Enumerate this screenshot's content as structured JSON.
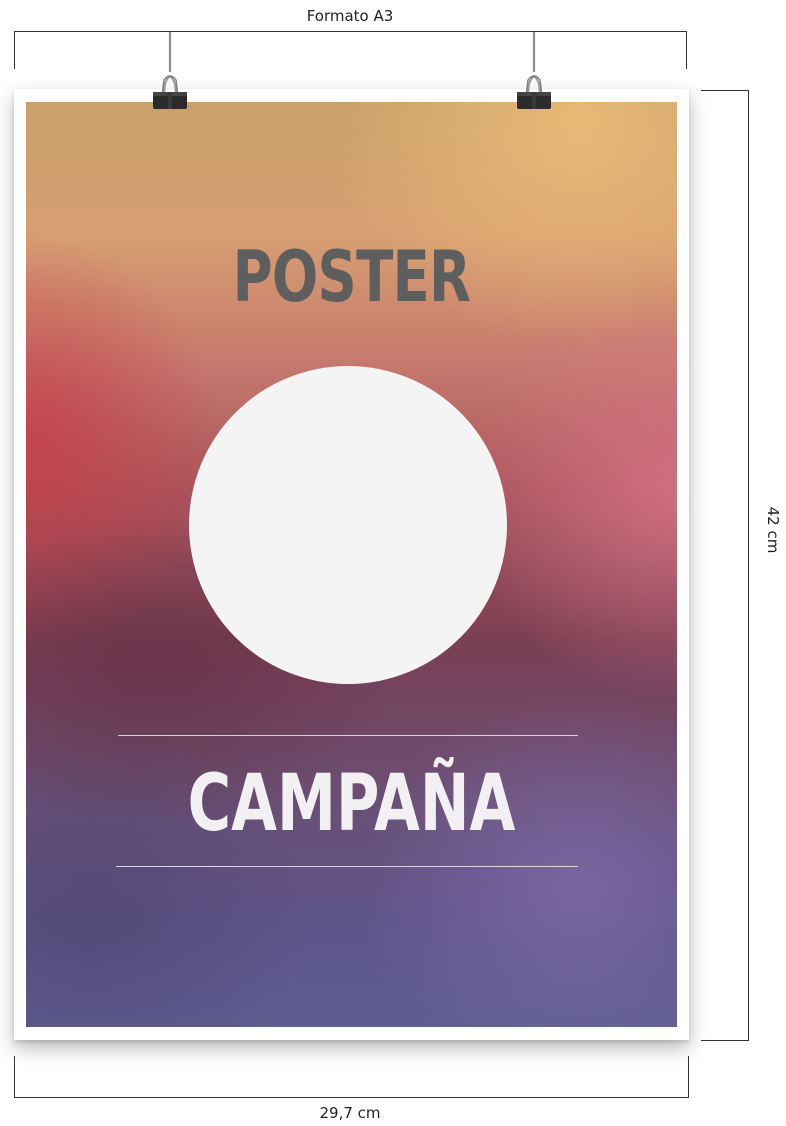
{
  "dimensions": {
    "top_label": "Formato A3",
    "right_label": "42 cm",
    "bottom_label": "29,7 cm"
  },
  "poster": {
    "title": "POSTER",
    "subtitle": "CAMPAÑA"
  },
  "colors": {
    "title_text": "#5e5e5e",
    "subtitle_text": "#f2f0f2",
    "circle": "#f4f4f4",
    "gradient_top": "#d9a870",
    "gradient_middle": "#a9545c",
    "gradient_bottom": "#5f5d92"
  },
  "icons": [
    "binder-clip-icon",
    "binder-clip-icon"
  ]
}
